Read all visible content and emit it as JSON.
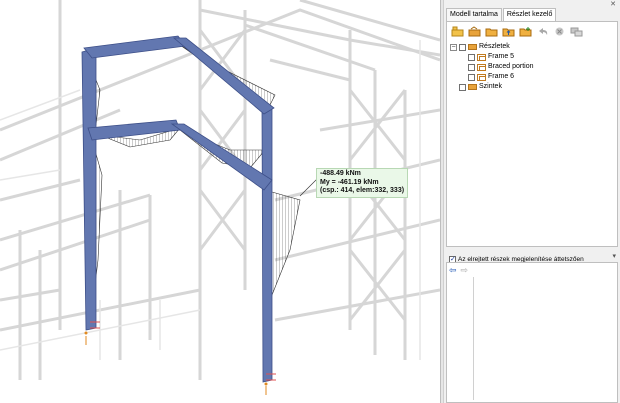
{
  "viewport": {
    "result_label": {
      "line1": "-488.49 kNm",
      "line2": "My = -461.19 kNm",
      "line3": "(csp.: 414, elem:332, 333)"
    }
  },
  "panel": {
    "tabs": [
      {
        "label": "Modell tartalma"
      },
      {
        "label": "Részlet kezelő"
      }
    ],
    "toolbar_icons": [
      "new-detail-icon",
      "new-detail-2-icon",
      "folder-icon",
      "folder-up-icon",
      "folder-add-icon",
      "undo-icon",
      "delete-icon",
      "settings-icon"
    ],
    "tree": {
      "root": {
        "label": "Részletek"
      },
      "children": [
        {
          "label": "Frame 5"
        },
        {
          "label": "Braced portion"
        },
        {
          "label": "Frame 6"
        }
      ],
      "second_root": {
        "label": "Szintek"
      }
    },
    "checkbar_label": "Az elrejtett részek megjelenítése áttetszően",
    "checkbar_checked": true
  },
  "colors": {
    "member_blue": "#6277b0",
    "frame_gray": "#d8d8d8",
    "label_bg": "#eaf8e8"
  }
}
